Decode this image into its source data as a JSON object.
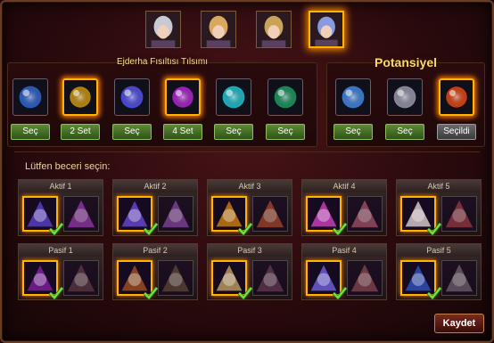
{
  "characters": [
    {
      "name": "white-hair-warrior",
      "hue": "#c9c9d6",
      "active": false
    },
    {
      "name": "blonde-warrior",
      "hue": "#d9a860",
      "active": false
    },
    {
      "name": "blonde-mage",
      "hue": "#caa35a",
      "active": false
    },
    {
      "name": "horned-demon",
      "hue": "#8a9ae0",
      "active": true
    }
  ],
  "talisman": {
    "title": "Ejderha Fısıltısı Tılsımı",
    "items": [
      {
        "icon": "moon-icon",
        "color": "#2a5bbf",
        "button": "Seç",
        "selected": false
      },
      {
        "icon": "gold-crystal-icon",
        "color": "#b8860b",
        "button": "2 Set",
        "selected": true
      },
      {
        "icon": "blue-orb-icon",
        "color": "#4a4ad8",
        "button": "Seç",
        "selected": false
      },
      {
        "icon": "purple-orb-icon",
        "color": "#a020c0",
        "button": "4 Set",
        "selected": true
      },
      {
        "icon": "cyan-orb-icon",
        "color": "#1ab2c0",
        "button": "Seç",
        "selected": false
      },
      {
        "icon": "green-orb-icon",
        "color": "#1a8a5a",
        "button": "Seç",
        "selected": false
      }
    ]
  },
  "potential": {
    "title": "Potansiyel",
    "items": [
      {
        "icon": "syringe-icon",
        "color": "#3a7acf",
        "button": "Seç",
        "selected": false,
        "gray": false
      },
      {
        "icon": "tornado-icon",
        "color": "#8a8aa0",
        "button": "Seç",
        "selected": false,
        "gray": false
      },
      {
        "icon": "flame-sword-icon",
        "color": "#d04010",
        "button": "Seçildi",
        "selected": true,
        "gray": true
      }
    ]
  },
  "skills_prompt": "Lütfen beceri seçin:",
  "active_skills": [
    {
      "label": "Aktif 1",
      "c1": "#5a40c8",
      "c2": "#b040d0"
    },
    {
      "label": "Aktif 2",
      "c1": "#6a48d8",
      "c2": "#9a50c0"
    },
    {
      "label": "Aktif 3",
      "c1": "#d08010",
      "c2": "#c05030"
    },
    {
      "label": "Aktif 4",
      "c1": "#d040c0",
      "c2": "#c06080"
    },
    {
      "label": "Aktif 5",
      "c1": "#e0d0d0",
      "c2": "#b04050"
    }
  ],
  "passive_skills": [
    {
      "label": "Pasif 1",
      "c1": "#8020a0",
      "c2": "#6a4050"
    },
    {
      "label": "Pasif 2",
      "c1": "#a05020",
      "c2": "#6a5040"
    },
    {
      "label": "Pasif 3",
      "c1": "#c0a060",
      "c2": "#704060"
    },
    {
      "label": "Pasif 4",
      "c1": "#7060e0",
      "c2": "#a05060"
    },
    {
      "label": "Pasif 5",
      "c1": "#3050c0",
      "c2": "#807080"
    }
  ],
  "save_label": "Kaydet"
}
